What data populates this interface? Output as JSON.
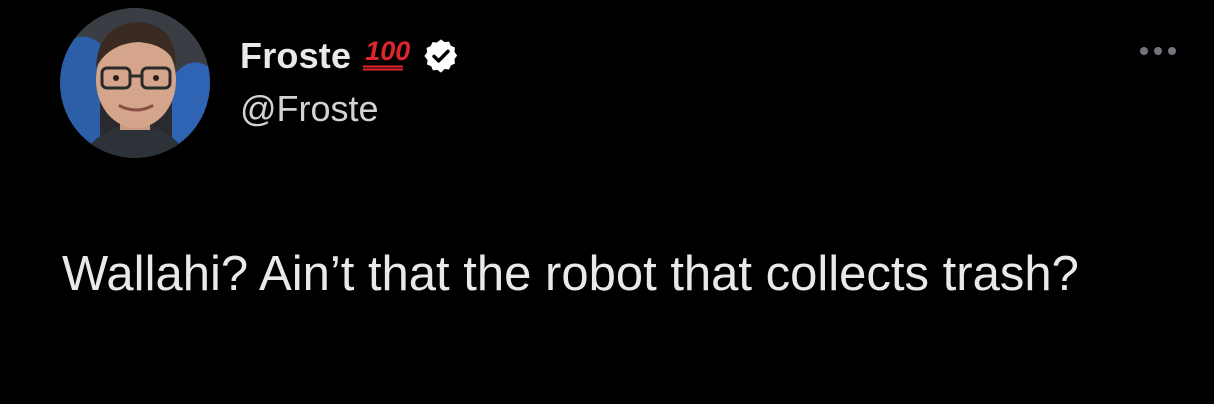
{
  "author": {
    "display_name": "Froste",
    "emoji_badge": "100",
    "emoji_badge_icon": "hundred-points-emoji",
    "verified_icon": "verified-badge-icon",
    "handle": "@Froste"
  },
  "menu": {
    "icon": "more-horizontal-icon"
  },
  "tweet": {
    "text": "Wallahi? Ain’t that the robot that collects trash?"
  },
  "colors": {
    "background": "#000000",
    "text_primary": "#e7e9ea",
    "text_secondary": "#d0d3d6",
    "emoji_red": "#e0262b",
    "muted_icon": "#71767b"
  }
}
